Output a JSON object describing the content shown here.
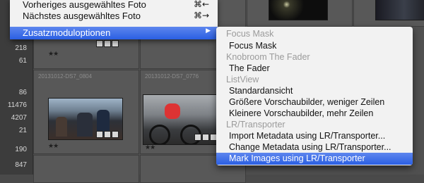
{
  "left_counts": [
    "",
    "",
    "",
    "218",
    "61",
    "",
    "86",
    "11476",
    "4207",
    "21",
    "190",
    "847"
  ],
  "thumbnails": [
    {
      "name": "20131012-DS7_0804",
      "stars": "★★"
    },
    {
      "name": "20131012-DS7_0776",
      "stars": "★★"
    },
    {
      "name": "",
      "stars": "★★"
    }
  ],
  "main_menu": {
    "prev_item": {
      "label": "Vorheriges ausgewähltes Foto",
      "shortcut": "⌘←"
    },
    "next_item": {
      "label": "Nächstes ausgewähltes Foto",
      "shortcut": "⌘→"
    },
    "plugin_options": {
      "label": "Zusatzmoduloptionen",
      "arrow": "▶"
    }
  },
  "submenu": {
    "focus_mask_header": "Focus Mask",
    "focus_mask_item": "Focus Mask",
    "fader_header": "Knobroom The Fader",
    "fader_item": "The Fader",
    "listview_header": "ListView",
    "listview_standard": "Standardansicht",
    "listview_larger": "Größere Vorschaubilder, weniger Zeilen",
    "listview_smaller": "Kleinere Vorschaubilder, mehr Zeilen",
    "transporter_header": "LR/Transporter",
    "transporter_import": "Import Metadata using LR/Transporter...",
    "transporter_change": "Change Metadata using LR/Transporter...",
    "transporter_mark": "Mark Images using LR/Transporter"
  }
}
